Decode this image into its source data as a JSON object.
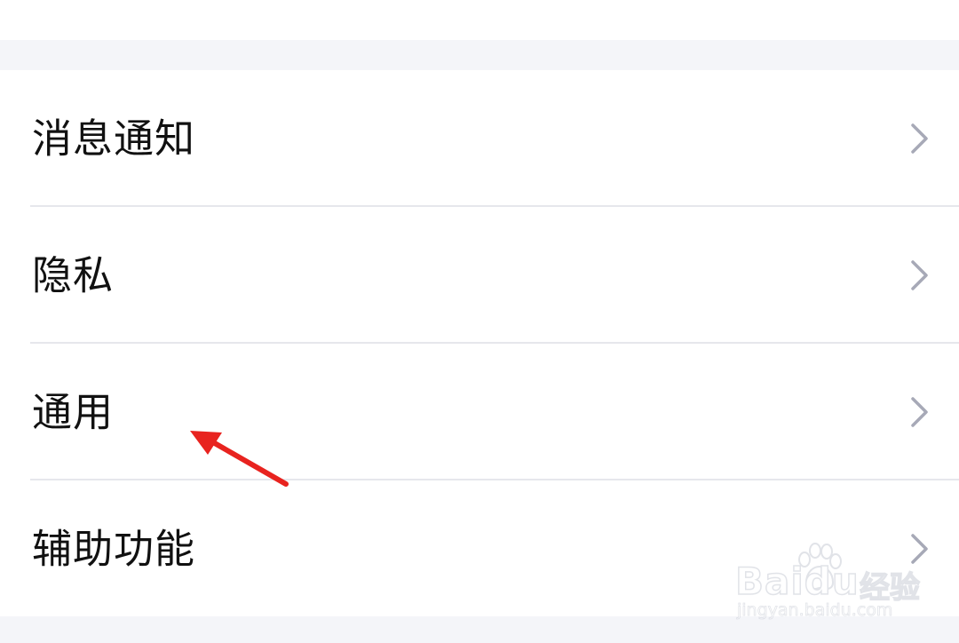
{
  "settings": {
    "items": [
      {
        "label": "消息通知",
        "icon": "chevron-right-icon"
      },
      {
        "label": "隐私",
        "icon": "chevron-right-icon"
      },
      {
        "label": "通用",
        "icon": "chevron-right-icon"
      },
      {
        "label": "辅助功能",
        "icon": "chevron-right-icon"
      }
    ]
  },
  "annotation": {
    "type": "arrow",
    "color": "#e8231f",
    "points_to": "通用"
  },
  "watermark": {
    "brand": "Baidu",
    "brand_cn": "经验",
    "url": "jingyan.baidu.com"
  },
  "colors": {
    "background": "#f4f5f9",
    "card": "#ffffff",
    "text": "#111111",
    "chevron": "#a7a9b7",
    "divider": "#e6e7ec"
  }
}
